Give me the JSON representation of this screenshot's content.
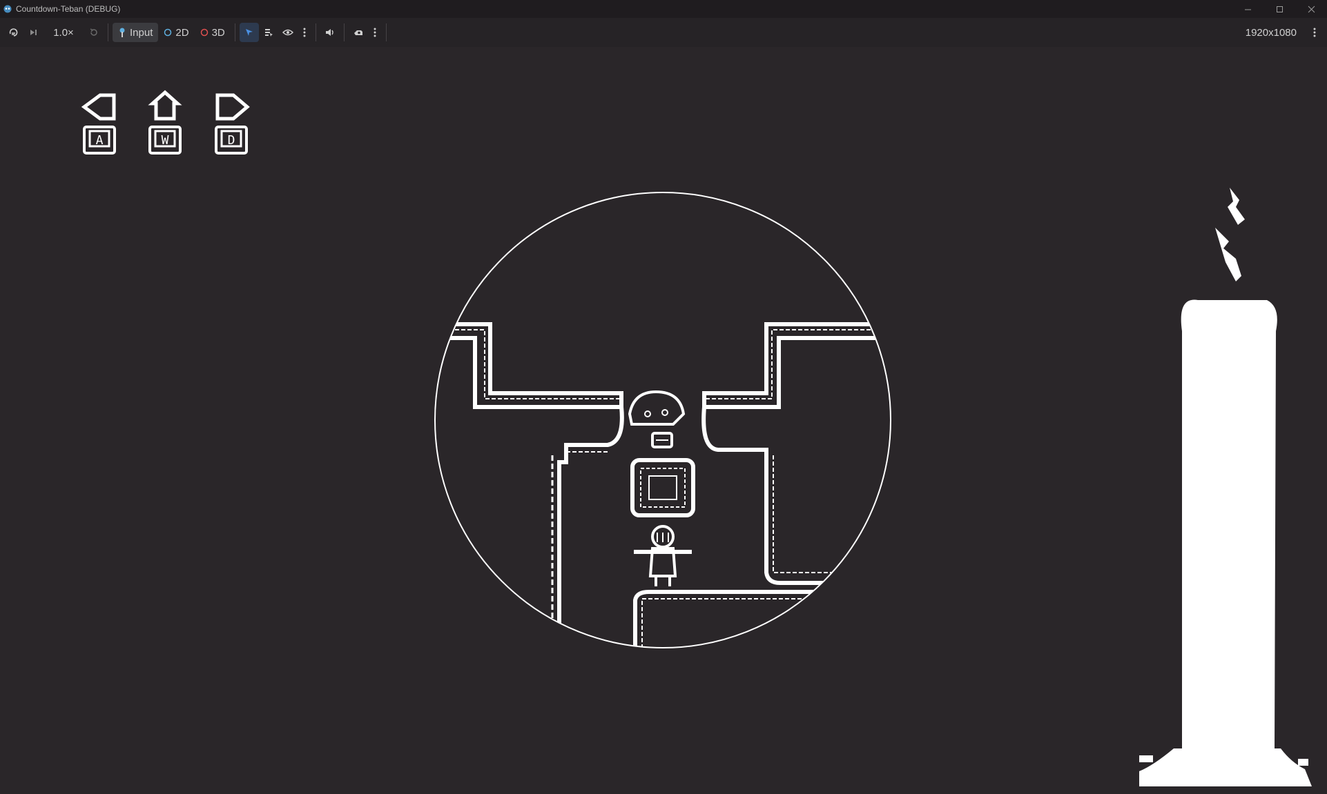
{
  "window": {
    "title": "Countdown-Teban (DEBUG)"
  },
  "toolbar": {
    "speed": "1.0×",
    "input_label": "Input",
    "mode_2d_label": "2D",
    "mode_3d_label": "3D",
    "resolution": "1920x1080"
  },
  "hud": {
    "controls": [
      {
        "direction": "left",
        "key": "A"
      },
      {
        "direction": "up",
        "key": "W"
      },
      {
        "direction": "right",
        "key": "D"
      }
    ]
  },
  "colors": {
    "background": "#2a2629",
    "foreground": "#ffffff",
    "accent_blue": "#4a90e2",
    "accent_3d": "#e05050",
    "accent_2d": "#5fb0e0"
  }
}
